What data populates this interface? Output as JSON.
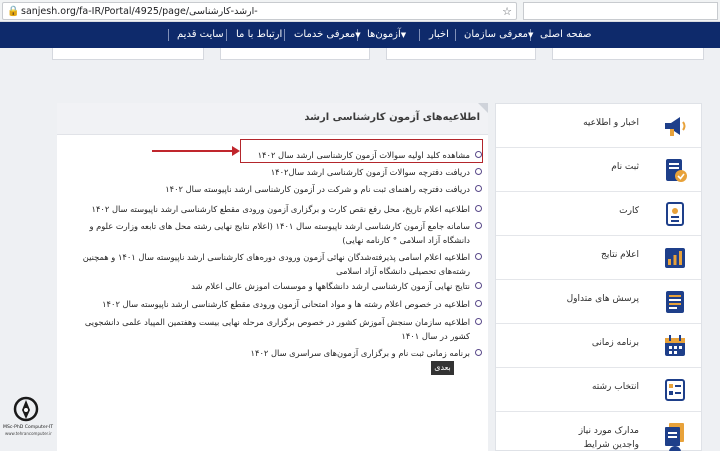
{
  "browser": {
    "url": "sanjesh.org/fa-IR/Portal/4925/page/ارشد-کارشناسی-"
  },
  "nav": {
    "items": [
      {
        "label": "صفحه اصلی"
      },
      {
        "label": "معرفی سازمان"
      },
      {
        "label": "اخبار"
      },
      {
        "label": "آزمون‌ها"
      },
      {
        "label": "معرفی خدمات"
      },
      {
        "label": "ارتباط با ما"
      },
      {
        "label": "سایت قدیم"
      }
    ]
  },
  "panel": {
    "title": "اطلاعیه‌های آزمون کارشناسی ارشد",
    "next_label": "بعدی",
    "news": [
      "مشاهده کلید اولیه سوالات آزمون کارشناسی ارشد سال ۱۴۰۲",
      "دریافت دفترچه سوالات آزمون کارشناسی ارشد سال۱۴۰۲",
      "دریافت دفترچه راهنمای ثبت نام و شرکت در آزمون کارشناسی ارشد ناپیوسته سال ۱۴۰۲",
      "اطلاعیه اعلام تاریخ، محل رفع نقص کارت و برگزاری آزمون ورودی مقطع کارشناسی ارشد ناپیوسته سال ۱۴۰۲",
      "سامانه جامع آزمون کارشناسی ارشد ناپیوسته سال ۱۴۰۱ (اعلام نتایج نهایی رشته محل های تابعه وزارت علوم و دانشگاه آزاد اسلامی ° کارنامه نهایی)",
      "اطلاعیه اعلام اسامی پذیرفته‌شدگان نهائی آزمون ورودی دوره‌های کارشناسی ارشد ناپیوسته سال ۱۴۰۱ و همچنین رشته‌های تحصیلی دانشگاه آزاد اسلامی",
      "نتایج نهایی آزمون کارشناسی ارشد دانشگاهها و موسسات اموزش عالی اعلام شد",
      "اطلاعیه در خصوص اعلام رشته ها و مواد امتحانی آزمون ورودی مقطع کارشناسی ارشد ناپیوسته سال ۱۴۰۲",
      "اطلاعیه سازمان سنجش آموزش کشور در خصوص برگزاری مرحله نهایی بیست وهفتمین المپیاد علمی دانشجویی کشور در سال ۱۴۰۱",
      "برنامه زمانی ثبت نام و برگزاری آزمون‌های سراسری سال ۱۴۰۲"
    ]
  },
  "sidebar": {
    "items": [
      {
        "label": "اخبار و اطلاعیه",
        "icon": "speaker-icon"
      },
      {
        "label": "ثبت نام",
        "icon": "clipboard-check-icon"
      },
      {
        "label": "کارت",
        "icon": "id-card-icon"
      },
      {
        "label": "اعلام نتایج",
        "icon": "results-icon"
      },
      {
        "label": "پرسش های متداول",
        "icon": "faq-document-icon"
      },
      {
        "label": "برنامه زمانی",
        "icon": "calendar-icon"
      },
      {
        "label": "انتخاب رشته",
        "icon": "choice-form-icon"
      },
      {
        "label": "مدارک مورد نیاز",
        "icon": "documents-icon"
      },
      {
        "label": "واجدین شرایط",
        "icon": "eligible-icon"
      }
    ]
  },
  "logo": {
    "line1": "MSc-PhD Computer-IT",
    "line2": "www.tehrancomputer.ir"
  },
  "colors": {
    "nav_bg": "#0e2a6b",
    "highlight": "#c0262d",
    "accent_orange": "#e8a23a",
    "accent_blue": "#1e3f8a"
  }
}
